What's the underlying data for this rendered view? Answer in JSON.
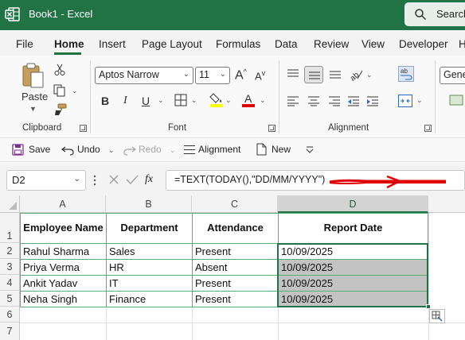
{
  "app": {
    "window_title": "Book1  -  Excel",
    "search_label": "Search",
    "brand_color": "#217346"
  },
  "menu_tabs": [
    "File",
    "Home",
    "Insert",
    "Page Layout",
    "Formulas",
    "Data",
    "Review",
    "View",
    "Developer",
    "H"
  ],
  "active_tab": "Home",
  "ribbon": {
    "clipboard": {
      "paste_label": "Paste",
      "group_label": "Clipboard"
    },
    "font": {
      "font_name": "Aptos Narrow",
      "font_size": "11",
      "bold": "B",
      "italic": "I",
      "underline": "U",
      "grow_glyph": "A",
      "shrink_glyph": "A",
      "group_label": "Font",
      "highlight_color": "#ffff00",
      "font_color": "#e00000"
    },
    "alignment": {
      "group_label": "Alignment"
    },
    "number": {
      "format_label": "Gene"
    }
  },
  "qat": {
    "save": "Save",
    "undo": "Undo",
    "redo": "Redo",
    "alignment": "Alignment",
    "new": "New"
  },
  "formula_bar": {
    "name_box": "D2",
    "fx": "fx",
    "formula": "=TEXT(TODAY(),\"DD/MM/YYYY\")"
  },
  "sheet": {
    "columns": [
      "A",
      "B",
      "C",
      "D"
    ],
    "rows": [
      "1",
      "2",
      "3",
      "4",
      "5",
      "6",
      "7"
    ],
    "selected_column": "D",
    "header_row": [
      "Employee Name",
      "Department",
      "Attendance",
      "Report Date"
    ],
    "data_rows": [
      [
        "Rahul Sharma",
        "Sales",
        "Present",
        "10/09/2025"
      ],
      [
        "Priya Verma",
        "HR",
        "Absent",
        "10/09/2025"
      ],
      [
        "Ankit Yadav",
        "IT",
        "Present",
        "10/09/2025"
      ],
      [
        "Neha Singh",
        "Finance",
        "Present",
        "10/09/2025"
      ]
    ],
    "selection_range": "D2:D5"
  }
}
